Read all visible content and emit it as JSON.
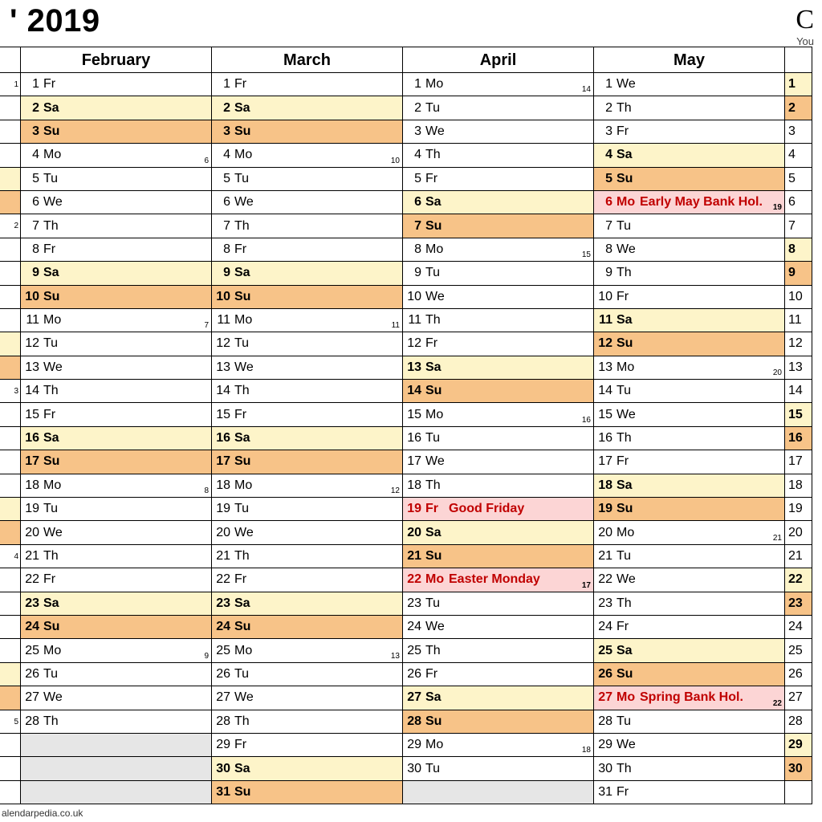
{
  "title": "' 2019",
  "brand": "C",
  "brand_sub": "You",
  "footer": "alendarpedia.co.uk",
  "months": {
    "jan": {
      "name": ""
    },
    "feb": {
      "name": "February"
    },
    "mar": {
      "name": "March"
    },
    "apr": {
      "name": "April"
    },
    "may": {
      "name": "May"
    },
    "jun": {
      "name": ""
    }
  },
  "jan_days": [
    {
      "wk": "1",
      "cls": ""
    },
    {
      "wk": "",
      "cls": ""
    },
    {
      "wk": "",
      "cls": ""
    },
    {
      "wk": "",
      "cls": ""
    },
    {
      "wk": "",
      "cls": "sat"
    },
    {
      "wk": "",
      "cls": "sun"
    },
    {
      "wk": "2",
      "cls": ""
    },
    {
      "wk": "",
      "cls": ""
    },
    {
      "wk": "",
      "cls": ""
    },
    {
      "wk": "",
      "cls": ""
    },
    {
      "wk": "",
      "cls": ""
    },
    {
      "wk": "",
      "cls": "sat"
    },
    {
      "wk": "",
      "cls": "sun"
    },
    {
      "wk": "3",
      "cls": ""
    },
    {
      "wk": "",
      "cls": ""
    },
    {
      "wk": "",
      "cls": ""
    },
    {
      "wk": "",
      "cls": ""
    },
    {
      "wk": "",
      "cls": ""
    },
    {
      "wk": "",
      "cls": "sat"
    },
    {
      "wk": "",
      "cls": "sun"
    },
    {
      "wk": "4",
      "cls": ""
    },
    {
      "wk": "",
      "cls": ""
    },
    {
      "wk": "",
      "cls": ""
    },
    {
      "wk": "",
      "cls": ""
    },
    {
      "wk": "",
      "cls": ""
    },
    {
      "wk": "",
      "cls": "sat"
    },
    {
      "wk": "",
      "cls": "sun"
    },
    {
      "wk": "5",
      "cls": ""
    },
    {
      "wk": "",
      "cls": ""
    },
    {
      "wk": "",
      "cls": ""
    },
    {
      "wk": "",
      "cls": ""
    }
  ],
  "feb_days": [
    {
      "d": "1",
      "dow": "Fr",
      "cls": "",
      "wk": ""
    },
    {
      "d": "2",
      "dow": "Sa",
      "cls": "sat",
      "wk": ""
    },
    {
      "d": "3",
      "dow": "Su",
      "cls": "sun",
      "wk": ""
    },
    {
      "d": "4",
      "dow": "Mo",
      "cls": "",
      "wk": "6"
    },
    {
      "d": "5",
      "dow": "Tu",
      "cls": "",
      "wk": ""
    },
    {
      "d": "6",
      "dow": "We",
      "cls": "",
      "wk": ""
    },
    {
      "d": "7",
      "dow": "Th",
      "cls": "",
      "wk": ""
    },
    {
      "d": "8",
      "dow": "Fr",
      "cls": "",
      "wk": ""
    },
    {
      "d": "9",
      "dow": "Sa",
      "cls": "sat",
      "wk": ""
    },
    {
      "d": "10",
      "dow": "Su",
      "cls": "sun",
      "wk": ""
    },
    {
      "d": "11",
      "dow": "Mo",
      "cls": "",
      "wk": "7"
    },
    {
      "d": "12",
      "dow": "Tu",
      "cls": "",
      "wk": ""
    },
    {
      "d": "13",
      "dow": "We",
      "cls": "",
      "wk": ""
    },
    {
      "d": "14",
      "dow": "Th",
      "cls": "",
      "wk": ""
    },
    {
      "d": "15",
      "dow": "Fr",
      "cls": "",
      "wk": ""
    },
    {
      "d": "16",
      "dow": "Sa",
      "cls": "sat",
      "wk": ""
    },
    {
      "d": "17",
      "dow": "Su",
      "cls": "sun",
      "wk": ""
    },
    {
      "d": "18",
      "dow": "Mo",
      "cls": "",
      "wk": "8"
    },
    {
      "d": "19",
      "dow": "Tu",
      "cls": "",
      "wk": ""
    },
    {
      "d": "20",
      "dow": "We",
      "cls": "",
      "wk": ""
    },
    {
      "d": "21",
      "dow": "Th",
      "cls": "",
      "wk": ""
    },
    {
      "d": "22",
      "dow": "Fr",
      "cls": "",
      "wk": ""
    },
    {
      "d": "23",
      "dow": "Sa",
      "cls": "sat",
      "wk": ""
    },
    {
      "d": "24",
      "dow": "Su",
      "cls": "sun",
      "wk": ""
    },
    {
      "d": "25",
      "dow": "Mo",
      "cls": "",
      "wk": "9"
    },
    {
      "d": "26",
      "dow": "Tu",
      "cls": "",
      "wk": ""
    },
    {
      "d": "27",
      "dow": "We",
      "cls": "",
      "wk": ""
    },
    {
      "d": "28",
      "dow": "Th",
      "cls": "",
      "wk": ""
    },
    {
      "d": "",
      "dow": "",
      "cls": "blank",
      "wk": ""
    },
    {
      "d": "",
      "dow": "",
      "cls": "blank",
      "wk": ""
    },
    {
      "d": "",
      "dow": "",
      "cls": "blank",
      "wk": ""
    }
  ],
  "mar_days": [
    {
      "d": "1",
      "dow": "Fr",
      "cls": "",
      "wk": ""
    },
    {
      "d": "2",
      "dow": "Sa",
      "cls": "sat",
      "wk": ""
    },
    {
      "d": "3",
      "dow": "Su",
      "cls": "sun",
      "wk": ""
    },
    {
      "d": "4",
      "dow": "Mo",
      "cls": "",
      "wk": "10"
    },
    {
      "d": "5",
      "dow": "Tu",
      "cls": "",
      "wk": ""
    },
    {
      "d": "6",
      "dow": "We",
      "cls": "",
      "wk": ""
    },
    {
      "d": "7",
      "dow": "Th",
      "cls": "",
      "wk": ""
    },
    {
      "d": "8",
      "dow": "Fr",
      "cls": "",
      "wk": ""
    },
    {
      "d": "9",
      "dow": "Sa",
      "cls": "sat",
      "wk": ""
    },
    {
      "d": "10",
      "dow": "Su",
      "cls": "sun",
      "wk": ""
    },
    {
      "d": "11",
      "dow": "Mo",
      "cls": "",
      "wk": "11"
    },
    {
      "d": "12",
      "dow": "Tu",
      "cls": "",
      "wk": ""
    },
    {
      "d": "13",
      "dow": "We",
      "cls": "",
      "wk": ""
    },
    {
      "d": "14",
      "dow": "Th",
      "cls": "",
      "wk": ""
    },
    {
      "d": "15",
      "dow": "Fr",
      "cls": "",
      "wk": ""
    },
    {
      "d": "16",
      "dow": "Sa",
      "cls": "sat",
      "wk": ""
    },
    {
      "d": "17",
      "dow": "Su",
      "cls": "sun",
      "wk": ""
    },
    {
      "d": "18",
      "dow": "Mo",
      "cls": "",
      "wk": "12"
    },
    {
      "d": "19",
      "dow": "Tu",
      "cls": "",
      "wk": ""
    },
    {
      "d": "20",
      "dow": "We",
      "cls": "",
      "wk": ""
    },
    {
      "d": "21",
      "dow": "Th",
      "cls": "",
      "wk": ""
    },
    {
      "d": "22",
      "dow": "Fr",
      "cls": "",
      "wk": ""
    },
    {
      "d": "23",
      "dow": "Sa",
      "cls": "sat",
      "wk": ""
    },
    {
      "d": "24",
      "dow": "Su",
      "cls": "sun",
      "wk": ""
    },
    {
      "d": "25",
      "dow": "Mo",
      "cls": "",
      "wk": "13"
    },
    {
      "d": "26",
      "dow": "Tu",
      "cls": "",
      "wk": ""
    },
    {
      "d": "27",
      "dow": "We",
      "cls": "",
      "wk": ""
    },
    {
      "d": "28",
      "dow": "Th",
      "cls": "",
      "wk": ""
    },
    {
      "d": "29",
      "dow": "Fr",
      "cls": "",
      "wk": ""
    },
    {
      "d": "30",
      "dow": "Sa",
      "cls": "sat",
      "wk": ""
    },
    {
      "d": "31",
      "dow": "Su",
      "cls": "sun",
      "wk": ""
    }
  ],
  "apr_days": [
    {
      "d": "1",
      "dow": "Mo",
      "cls": "",
      "wk": "14"
    },
    {
      "d": "2",
      "dow": "Tu",
      "cls": "",
      "wk": ""
    },
    {
      "d": "3",
      "dow": "We",
      "cls": "",
      "wk": ""
    },
    {
      "d": "4",
      "dow": "Th",
      "cls": "",
      "wk": ""
    },
    {
      "d": "5",
      "dow": "Fr",
      "cls": "",
      "wk": ""
    },
    {
      "d": "6",
      "dow": "Sa",
      "cls": "sat",
      "wk": ""
    },
    {
      "d": "7",
      "dow": "Su",
      "cls": "sun",
      "wk": ""
    },
    {
      "d": "8",
      "dow": "Mo",
      "cls": "",
      "wk": "15"
    },
    {
      "d": "9",
      "dow": "Tu",
      "cls": "",
      "wk": ""
    },
    {
      "d": "10",
      "dow": "We",
      "cls": "",
      "wk": ""
    },
    {
      "d": "11",
      "dow": "Th",
      "cls": "",
      "wk": ""
    },
    {
      "d": "12",
      "dow": "Fr",
      "cls": "",
      "wk": ""
    },
    {
      "d": "13",
      "dow": "Sa",
      "cls": "sat",
      "wk": ""
    },
    {
      "d": "14",
      "dow": "Su",
      "cls": "sun",
      "wk": ""
    },
    {
      "d": "15",
      "dow": "Mo",
      "cls": "",
      "wk": "16"
    },
    {
      "d": "16",
      "dow": "Tu",
      "cls": "",
      "wk": ""
    },
    {
      "d": "17",
      "dow": "We",
      "cls": "",
      "wk": ""
    },
    {
      "d": "18",
      "dow": "Th",
      "cls": "",
      "wk": ""
    },
    {
      "d": "19",
      "dow": "Fr",
      "cls": "hol",
      "wk": "",
      "event": "Good Friday"
    },
    {
      "d": "20",
      "dow": "Sa",
      "cls": "sat",
      "wk": ""
    },
    {
      "d": "21",
      "dow": "Su",
      "cls": "sun",
      "wk": ""
    },
    {
      "d": "22",
      "dow": "Mo",
      "cls": "hol",
      "wk": "17",
      "event": "Easter Monday"
    },
    {
      "d": "23",
      "dow": "Tu",
      "cls": "",
      "wk": ""
    },
    {
      "d": "24",
      "dow": "We",
      "cls": "",
      "wk": ""
    },
    {
      "d": "25",
      "dow": "Th",
      "cls": "",
      "wk": ""
    },
    {
      "d": "26",
      "dow": "Fr",
      "cls": "",
      "wk": ""
    },
    {
      "d": "27",
      "dow": "Sa",
      "cls": "sat",
      "wk": ""
    },
    {
      "d": "28",
      "dow": "Su",
      "cls": "sun",
      "wk": ""
    },
    {
      "d": "29",
      "dow": "Mo",
      "cls": "",
      "wk": "18"
    },
    {
      "d": "30",
      "dow": "Tu",
      "cls": "",
      "wk": ""
    },
    {
      "d": "",
      "dow": "",
      "cls": "blank",
      "wk": ""
    }
  ],
  "may_days": [
    {
      "d": "1",
      "dow": "We",
      "cls": "",
      "wk": ""
    },
    {
      "d": "2",
      "dow": "Th",
      "cls": "",
      "wk": ""
    },
    {
      "d": "3",
      "dow": "Fr",
      "cls": "",
      "wk": ""
    },
    {
      "d": "4",
      "dow": "Sa",
      "cls": "sat",
      "wk": ""
    },
    {
      "d": "5",
      "dow": "Su",
      "cls": "sun",
      "wk": ""
    },
    {
      "d": "6",
      "dow": "Mo",
      "cls": "hol",
      "wk": "19",
      "event": "Early May Bank Hol."
    },
    {
      "d": "7",
      "dow": "Tu",
      "cls": "",
      "wk": ""
    },
    {
      "d": "8",
      "dow": "We",
      "cls": "",
      "wk": ""
    },
    {
      "d": "9",
      "dow": "Th",
      "cls": "",
      "wk": ""
    },
    {
      "d": "10",
      "dow": "Fr",
      "cls": "",
      "wk": ""
    },
    {
      "d": "11",
      "dow": "Sa",
      "cls": "sat",
      "wk": ""
    },
    {
      "d": "12",
      "dow": "Su",
      "cls": "sun",
      "wk": ""
    },
    {
      "d": "13",
      "dow": "Mo",
      "cls": "",
      "wk": "20"
    },
    {
      "d": "14",
      "dow": "Tu",
      "cls": "",
      "wk": ""
    },
    {
      "d": "15",
      "dow": "We",
      "cls": "",
      "wk": ""
    },
    {
      "d": "16",
      "dow": "Th",
      "cls": "",
      "wk": ""
    },
    {
      "d": "17",
      "dow": "Fr",
      "cls": "",
      "wk": ""
    },
    {
      "d": "18",
      "dow": "Sa",
      "cls": "sat",
      "wk": ""
    },
    {
      "d": "19",
      "dow": "Su",
      "cls": "sun",
      "wk": ""
    },
    {
      "d": "20",
      "dow": "Mo",
      "cls": "",
      "wk": "21"
    },
    {
      "d": "21",
      "dow": "Tu",
      "cls": "",
      "wk": ""
    },
    {
      "d": "22",
      "dow": "We",
      "cls": "",
      "wk": ""
    },
    {
      "d": "23",
      "dow": "Th",
      "cls": "",
      "wk": ""
    },
    {
      "d": "24",
      "dow": "Fr",
      "cls": "",
      "wk": ""
    },
    {
      "d": "25",
      "dow": "Sa",
      "cls": "sat",
      "wk": ""
    },
    {
      "d": "26",
      "dow": "Su",
      "cls": "sun",
      "wk": ""
    },
    {
      "d": "27",
      "dow": "Mo",
      "cls": "hol",
      "wk": "22",
      "event": "Spring Bank Hol."
    },
    {
      "d": "28",
      "dow": "Tu",
      "cls": "",
      "wk": ""
    },
    {
      "d": "29",
      "dow": "We",
      "cls": "",
      "wk": ""
    },
    {
      "d": "30",
      "dow": "Th",
      "cls": "",
      "wk": ""
    },
    {
      "d": "31",
      "dow": "Fr",
      "cls": "",
      "wk": ""
    }
  ],
  "jun_days": [
    {
      "d": "1",
      "cls": "sat"
    },
    {
      "d": "2",
      "cls": "sun"
    },
    {
      "d": "3",
      "cls": ""
    },
    {
      "d": "4",
      "cls": ""
    },
    {
      "d": "5",
      "cls": ""
    },
    {
      "d": "6",
      "cls": ""
    },
    {
      "d": "7",
      "cls": ""
    },
    {
      "d": "8",
      "cls": "sat"
    },
    {
      "d": "9",
      "cls": "sun"
    },
    {
      "d": "10",
      "cls": ""
    },
    {
      "d": "11",
      "cls": ""
    },
    {
      "d": "12",
      "cls": ""
    },
    {
      "d": "13",
      "cls": ""
    },
    {
      "d": "14",
      "cls": ""
    },
    {
      "d": "15",
      "cls": "sat"
    },
    {
      "d": "16",
      "cls": "sun"
    },
    {
      "d": "17",
      "cls": ""
    },
    {
      "d": "18",
      "cls": ""
    },
    {
      "d": "19",
      "cls": ""
    },
    {
      "d": "20",
      "cls": ""
    },
    {
      "d": "21",
      "cls": ""
    },
    {
      "d": "22",
      "cls": "sat"
    },
    {
      "d": "23",
      "cls": "sun"
    },
    {
      "d": "24",
      "cls": ""
    },
    {
      "d": "25",
      "cls": ""
    },
    {
      "d": "26",
      "cls": ""
    },
    {
      "d": "27",
      "cls": ""
    },
    {
      "d": "28",
      "cls": ""
    },
    {
      "d": "29",
      "cls": "sat"
    },
    {
      "d": "30",
      "cls": "sun"
    },
    {
      "d": "",
      "cls": "blank"
    }
  ]
}
